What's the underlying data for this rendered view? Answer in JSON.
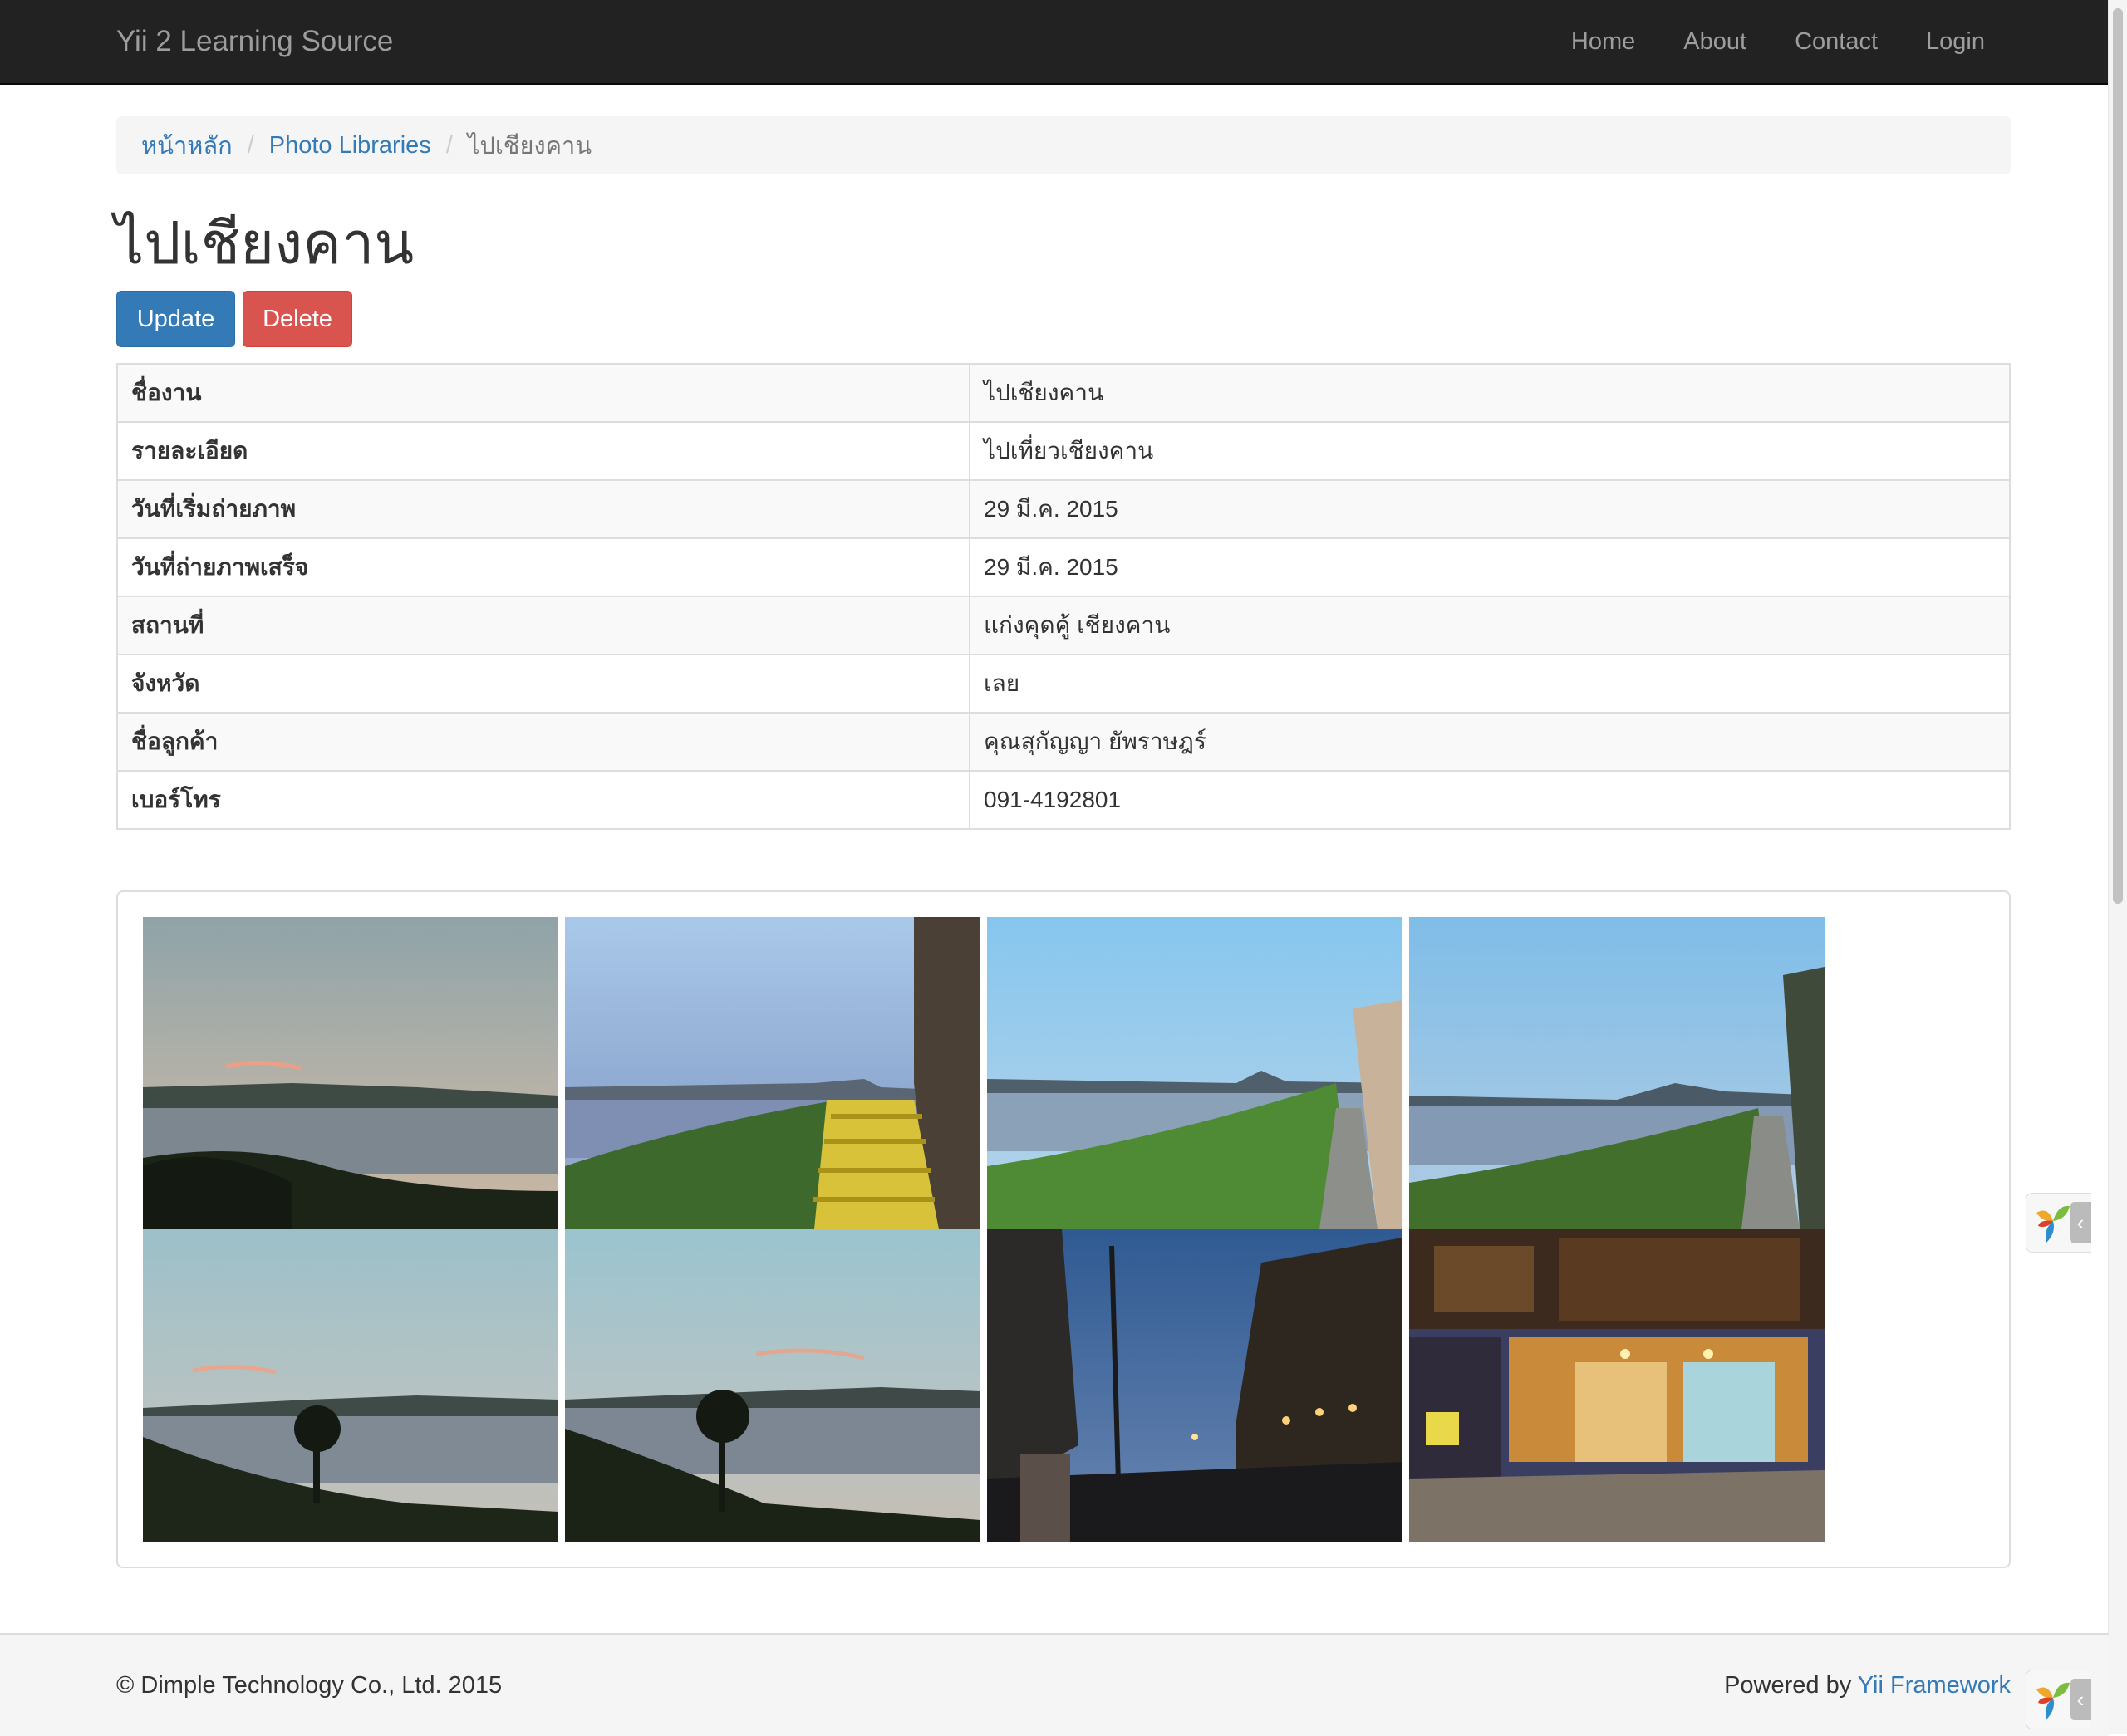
{
  "navbar": {
    "brand": "Yii 2 Learning Source",
    "items": [
      {
        "label": "Home"
      },
      {
        "label": "About"
      },
      {
        "label": "Contact"
      },
      {
        "label": "Login"
      }
    ]
  },
  "breadcrumb": {
    "home": "หน้าหลัก",
    "section": "Photo Libraries",
    "current": "ไปเชียงคาน",
    "separator": "/"
  },
  "page": {
    "title": "ไปเชียงคาน",
    "update_label": "Update",
    "delete_label": "Delete"
  },
  "details": [
    {
      "label": "ชื่องาน",
      "value": "ไปเชียงคาน"
    },
    {
      "label": "รายละเอียด",
      "value": "ไปเที่ยวเชียงคาน"
    },
    {
      "label": "วันที่เริ่มถ่ายภาพ",
      "value": "29 มี.ค. 2015"
    },
    {
      "label": "วันที่ถ่ายภาพเสร็จ",
      "value": "29 มี.ค. 2015"
    },
    {
      "label": "สถานที่",
      "value": "แก่งคุดคู้ เชียงคาน"
    },
    {
      "label": "จังหวัด",
      "value": "เลย"
    },
    {
      "label": "ชื่อลูกค้า",
      "value": "คุณสุกัญญา ยัพราษฎร์"
    },
    {
      "label": "เบอร์โทร",
      "value": "091-4192801"
    }
  ],
  "gallery": {
    "photo_count": 8
  },
  "footer": {
    "copyright": "© Dimple Technology Co., Ltd. 2015",
    "powered_prefix": "Powered by ",
    "framework_link": "Yii Framework"
  },
  "colors": {
    "navbar": "#222222",
    "link": "#337ab7",
    "primary": "#337ab7",
    "danger": "#d9534f"
  }
}
